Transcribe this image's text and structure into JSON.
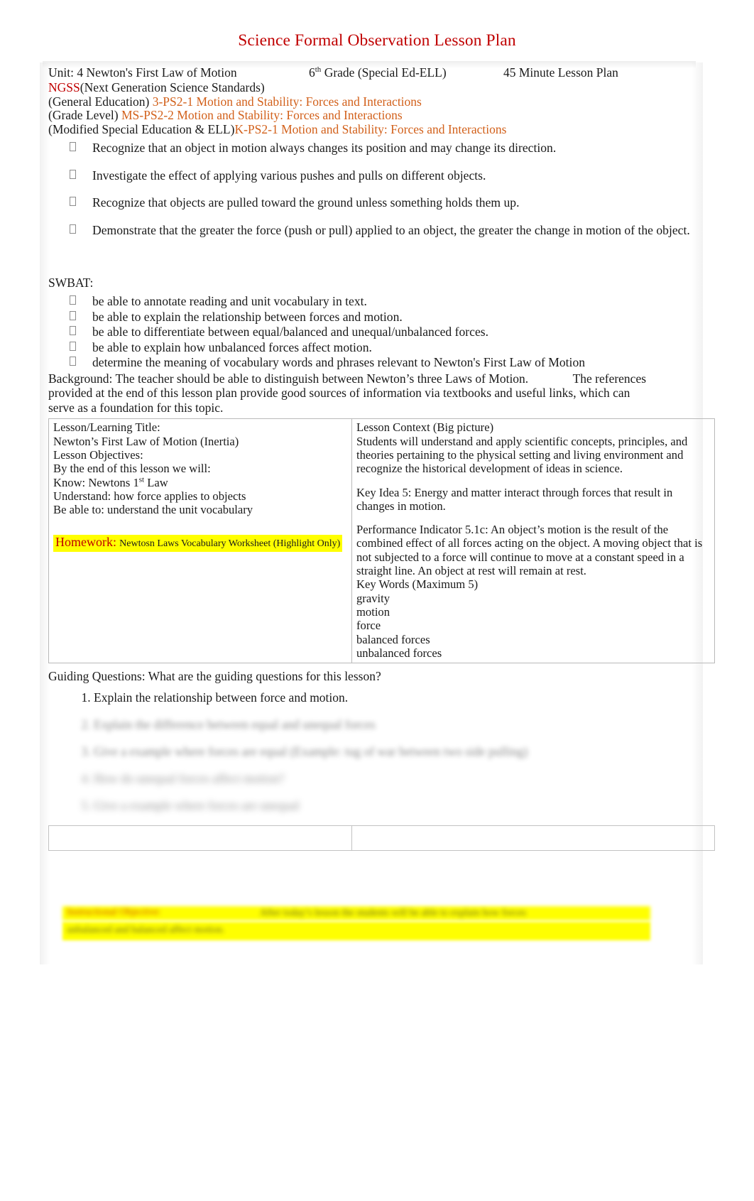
{
  "document": {
    "title": "Science Formal Observation Lesson Plan",
    "title_color": "#c00000",
    "accent_orange": "#d2601a",
    "highlight_color": "#ffff00"
  },
  "header": {
    "unit": "Unit: 4  Newton's First Law of Motion",
    "grade_prefix": "6",
    "grade_sup": "th",
    "grade_suffix": " Grade (Special Ed-ELL)",
    "duration": "45 Minute Lesson Plan"
  },
  "standards": {
    "ngss_label": "NGSS",
    "ngss_expansion": "(Next Generation Science Standards)",
    "rows": [
      {
        "label": "(General Education) ",
        "code": "3-PS2-1 Motion and Stability: Forces and Interactions"
      },
      {
        "label": "(Grade Level) ",
        "code": "MS-PS2-2 Motion and Stability: Forces and Interactions"
      },
      {
        "label": "(Modified Special Education & ELL)",
        "code": "K-PS2-1 Motion and Stability: Forces and Interactions"
      }
    ],
    "bullets": [
      "Recognize that an object in motion always changes its position and may change its direction.",
      "Investigate the effect of applying various pushes and pulls on different objects.",
      "Recognize that objects are pulled toward the ground unless something holds them up.",
      "Demonstrate that the greater the force (push or pull) applied to an object, the greater the change in motion of the object."
    ]
  },
  "swbat": {
    "heading": "SWBAT:",
    "items": [
      "be able to annotate reading and unit vocabulary in text.",
      "be able to explain the relationship between forces and motion.",
      "be able to differentiate between equal/balanced and unequal/unbalanced forces.",
      "be able to explain how unbalanced forces affect motion.",
      "determine the meaning of vocabulary words and phrases relevant to Newton's First Law of Motion"
    ]
  },
  "background": {
    "line1": "Background: The teacher should be able to distinguish between Newton’s three Laws of Motion.",
    "line1_tail": "The references",
    "line2": "provided at the end of this lesson plan provide good sources of information via textbooks and useful links, which can",
    "line3": "serve as a foundation for this topic."
  },
  "table": {
    "left": {
      "title_label": "Lesson/Learning Title:",
      "title_value": "Newton’s First Law of Motion (Inertia)",
      "objectives_label": "Lesson Objectives:",
      "objectives_intro": "By the end of this lesson we will:",
      "know_label": "Know: Newtons 1",
      "know_sup": "st",
      "know_tail": " Law",
      "understand": "Understand:   how force applies to objects",
      "beable": "Be able to:  understand the unit vocabulary",
      "homework_label": "Homework:",
      "homework_value": "Newtosn Laws Vocabulary Worksheet (Highlight Only)"
    },
    "right": {
      "context_label": "Lesson Context (Big picture)",
      "context_text": "Students will understand and apply scientific concepts, principles, and theories pertaining to the physical setting and living environment and recognize the historical development of ideas in science.",
      "key_idea": "Key Idea 5: Energy and matter interact through forces that result in changes in motion.",
      "performance_indicator": "Performance Indicator 5.1c: An object’s motion is the result of the combined effect of all forces acting on the object. A moving object that is not subjected to a force will continue to move at a constant speed in a straight line. An object at rest will remain at rest.",
      "keywords_label": "Key Words  (Maximum 5)",
      "keywords": [
        "gravity",
        "motion",
        "force",
        "balanced forces",
        "unbalanced forces"
      ]
    }
  },
  "guiding_questions": {
    "heading": "Guiding Questions: What are the guiding questions for this lesson?",
    "items": [
      "Explain the relationship between force and motion.",
      "Explain the difference between equal and unequal forces",
      "Give a example where forces are equal (Example: tug of war between two side pulling)",
      "How do unequal forces affect motion?",
      "Give a example where forces are unequal"
    ]
  },
  "bottom_table": {
    "left_cell": "",
    "right_cell": ""
  },
  "bottom_highlight": {
    "label": "Instructional Objective:",
    "line1": "After today’s lesson the students will be able to explain how forces",
    "line2": "unbalanced and balanced affect motion."
  }
}
